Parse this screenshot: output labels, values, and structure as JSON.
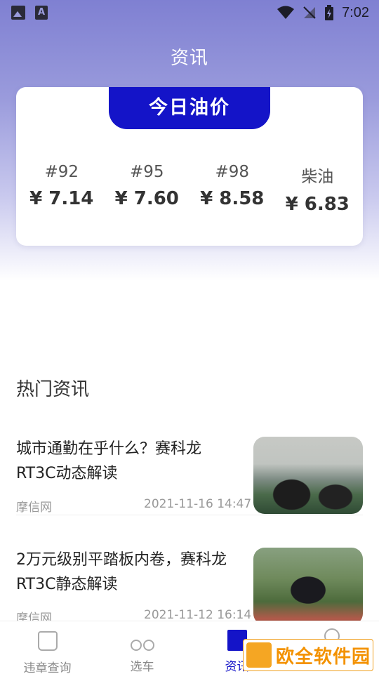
{
  "status_bar": {
    "time": "7:02"
  },
  "header": {
    "title": "资讯"
  },
  "oil": {
    "badge": "今日油价",
    "items": [
      {
        "grade": "#92",
        "price": "¥ 7.14"
      },
      {
        "grade": "#95",
        "price": "¥ 7.60"
      },
      {
        "grade": "#98",
        "price": "¥ 8.58"
      },
      {
        "grade": "柴油",
        "price": "¥ 6.83"
      }
    ]
  },
  "news": {
    "section_title": "热门资讯",
    "items": [
      {
        "title": "城市通勤在乎什么？赛科龙RT3C动态解读",
        "source": "摩信网",
        "date": "2021-11-16 14:47"
      },
      {
        "title": "2万元级别平踏板内卷，赛科龙RT3C静态解读",
        "source": "摩信网",
        "date": "2021-11-12 16:14"
      }
    ]
  },
  "nav": {
    "items": [
      {
        "label": "违章查询"
      },
      {
        "label": "选车"
      },
      {
        "label": "资讯"
      },
      {
        "label": "我的"
      }
    ],
    "active_color": "#1414c8"
  },
  "watermark": {
    "text": "欧全软件园"
  }
}
